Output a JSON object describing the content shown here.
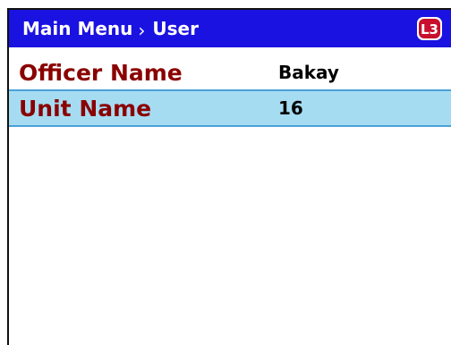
{
  "title_bar": {
    "breadcrumb": [
      "Main Menu",
      "User"
    ],
    "separator": "›",
    "logo_text": "L3",
    "background_color": "#1a12e0"
  },
  "rows": [
    {
      "label": "Officer Name",
      "value": "Bakay",
      "selected": false
    },
    {
      "label": "Unit Name",
      "value": "16",
      "selected": true
    }
  ],
  "colors": {
    "label": "#8a0000",
    "value": "#000000",
    "selected_row": "#a6dcf2",
    "selected_border": "#4aa2d8",
    "logo": "#c8102e"
  }
}
